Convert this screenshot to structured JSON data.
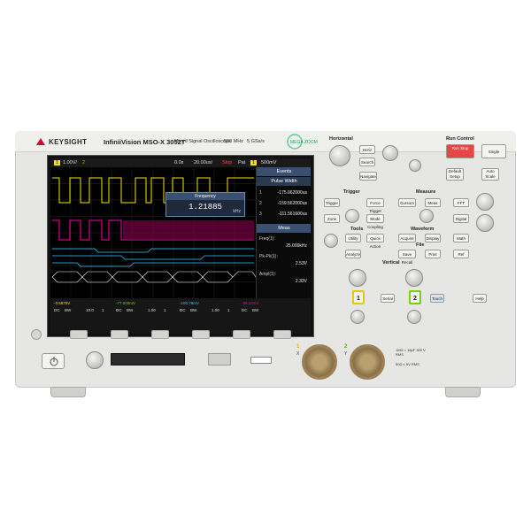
{
  "brand": "KEYSIGHT",
  "model": "InfiniiVision MSO-X 3052T",
  "subtitle": "Mixed Signal Oscilloscope",
  "bandwidth": "500 MHz",
  "sample_rate": "5 GSa/s",
  "megazoom_label": "MEGA ZOOM",
  "screen": {
    "top_bar": {
      "ch1_scale": "1.00V/",
      "ch2_marker": "2",
      "delay": "0.0s",
      "timebase": "20.00us/",
      "run_state": "Stop",
      "trigger_label": "Pat",
      "trigger_channel": "1",
      "trigger_level": "500mV"
    },
    "popup": {
      "title": "Frequency",
      "value": "1.21885",
      "unit": "kHz"
    },
    "side_panel": {
      "events_label": "Events",
      "pulse_width_label": "Pulse Width",
      "entries": [
        {
          "idx": "1",
          "value": "-175.062000us"
        },
        {
          "idx": "2",
          "value": "-159.562000us"
        },
        {
          "idx": "3",
          "value": "-111.561600us"
        }
      ],
      "meas_label": "Meas",
      "meas_items": [
        {
          "name": "Freq(1):",
          "value": "25.000kHz"
        },
        {
          "name": "Pk-Pk(1):",
          "value": "2.53V"
        },
        {
          "name": "Ampl(1):",
          "value": "2.33V"
        }
      ]
    },
    "bottom_bar": {
      "cells": [
        {
          "val": "-3.5875V",
          "coupling": "DC",
          "bw": "BW",
          "scale": "10.0",
          "ch": "1"
        },
        {
          "val": "-77.000mV",
          "coupling": "DC",
          "bw": "BW",
          "scale": "1.00",
          "ch": "1"
        },
        {
          "val": "-100.78mV",
          "coupling": "DC",
          "bw": "BW",
          "scale": "1.00",
          "ch": "1"
        },
        {
          "val": "-99.22mV",
          "coupling": "DC",
          "bw": "BW",
          "scale": "",
          "ch": ""
        }
      ]
    }
  },
  "controls": {
    "horizontal_label": "Horizontal",
    "run_control_label": "Run Control",
    "run_stop": "Run Stop",
    "single": "Single",
    "default_setup": "Default Setup",
    "auto_scale": "Auto Scale",
    "trigger_label": "Trigger",
    "measure_label": "Measure",
    "tools_label": "Tools",
    "waveform_label": "Waveform",
    "file_label": "File",
    "vertical_label": "Vertical",
    "buttons": {
      "horiz": "Horiz",
      "search": "Search",
      "navigate": "Navigate",
      "trigger": "Trigger",
      "force_trigger": "Force Trigger",
      "cursors": "Cursors",
      "meas": "Meas",
      "zone": "Zone",
      "level": "Level",
      "mode_coupling": "Mode Coupling",
      "fft": "FFT",
      "digital": "Digital",
      "math": "Math",
      "ref": "Ref",
      "utility": "Utility",
      "quick_action": "Quick Action",
      "acquire": "Acquire",
      "display": "Display",
      "analyze": "Analyze",
      "save_recall": "Save Recall",
      "print": "Print",
      "serial": "Serial",
      "touch": "Touch",
      "help": "Help",
      "ch1": "1",
      "ch2": "2"
    }
  },
  "front": {
    "ch1_label": "1",
    "ch1_sub": "X",
    "ch2_label": "2",
    "ch2_sub": "Y",
    "input_spec": "1MΩ = 16pF 300 V RMS",
    "input_spec2": "50Ω ≤ 5V RMS"
  },
  "colors": {
    "ch1": "#f5e600",
    "ch2": "#6fd400",
    "digital": "#ff00aa",
    "bus": "#33c8ff",
    "accent_blue": "#3a5070"
  }
}
